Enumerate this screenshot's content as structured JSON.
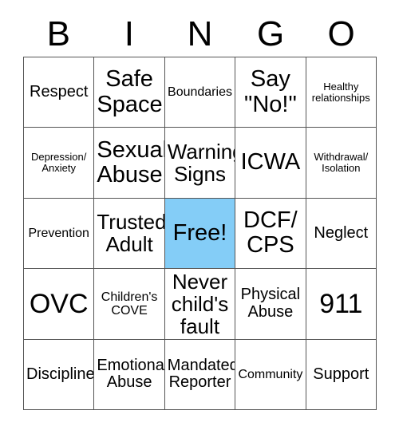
{
  "card": {
    "title_letters": [
      "B",
      "I",
      "N",
      "G",
      "O"
    ],
    "free_space_color": "#84cdf7",
    "border_color": "#555555",
    "background_color": "#ffffff",
    "rows": [
      [
        {
          "label": "Respect",
          "size": "md",
          "free": false
        },
        {
          "label": "Safe Space",
          "size": "xl",
          "free": false
        },
        {
          "label": "Boundaries",
          "size": "sm",
          "free": false
        },
        {
          "label": "Say \"No!\"",
          "size": "xl",
          "free": false
        },
        {
          "label": "Healthy relationships",
          "size": "xs",
          "free": false
        }
      ],
      [
        {
          "label": "Depression/ Anxiety",
          "size": "xs",
          "free": false
        },
        {
          "label": "Sexual Abuse",
          "size": "xl",
          "free": false
        },
        {
          "label": "Warning Signs",
          "size": "lg",
          "free": false
        },
        {
          "label": "ICWA",
          "size": "xl",
          "free": false
        },
        {
          "label": "Withdrawal/ Isolation",
          "size": "xs",
          "free": false
        }
      ],
      [
        {
          "label": "Prevention",
          "size": "sm",
          "free": false
        },
        {
          "label": "Trusted Adult",
          "size": "lg",
          "free": false
        },
        {
          "label": "Free!",
          "size": "xl",
          "free": true
        },
        {
          "label": "DCF/ CPS",
          "size": "xl",
          "free": false
        },
        {
          "label": "Neglect",
          "size": "md",
          "free": false
        }
      ],
      [
        {
          "label": "OVC",
          "size": "xxl",
          "free": false
        },
        {
          "label": "Children's COVE",
          "size": "sm",
          "free": false
        },
        {
          "label": "Never child's fault",
          "size": "lg",
          "free": false
        },
        {
          "label": "Physical Abuse",
          "size": "md",
          "free": false
        },
        {
          "label": "911",
          "size": "xxl",
          "free": false
        }
      ],
      [
        {
          "label": "Discipline",
          "size": "md",
          "free": false
        },
        {
          "label": "Emotional Abuse",
          "size": "md",
          "free": false
        },
        {
          "label": "Mandated Reporter",
          "size": "md",
          "free": false
        },
        {
          "label": "Community",
          "size": "sm",
          "free": false
        },
        {
          "label": "Support",
          "size": "md",
          "free": false
        }
      ]
    ]
  }
}
